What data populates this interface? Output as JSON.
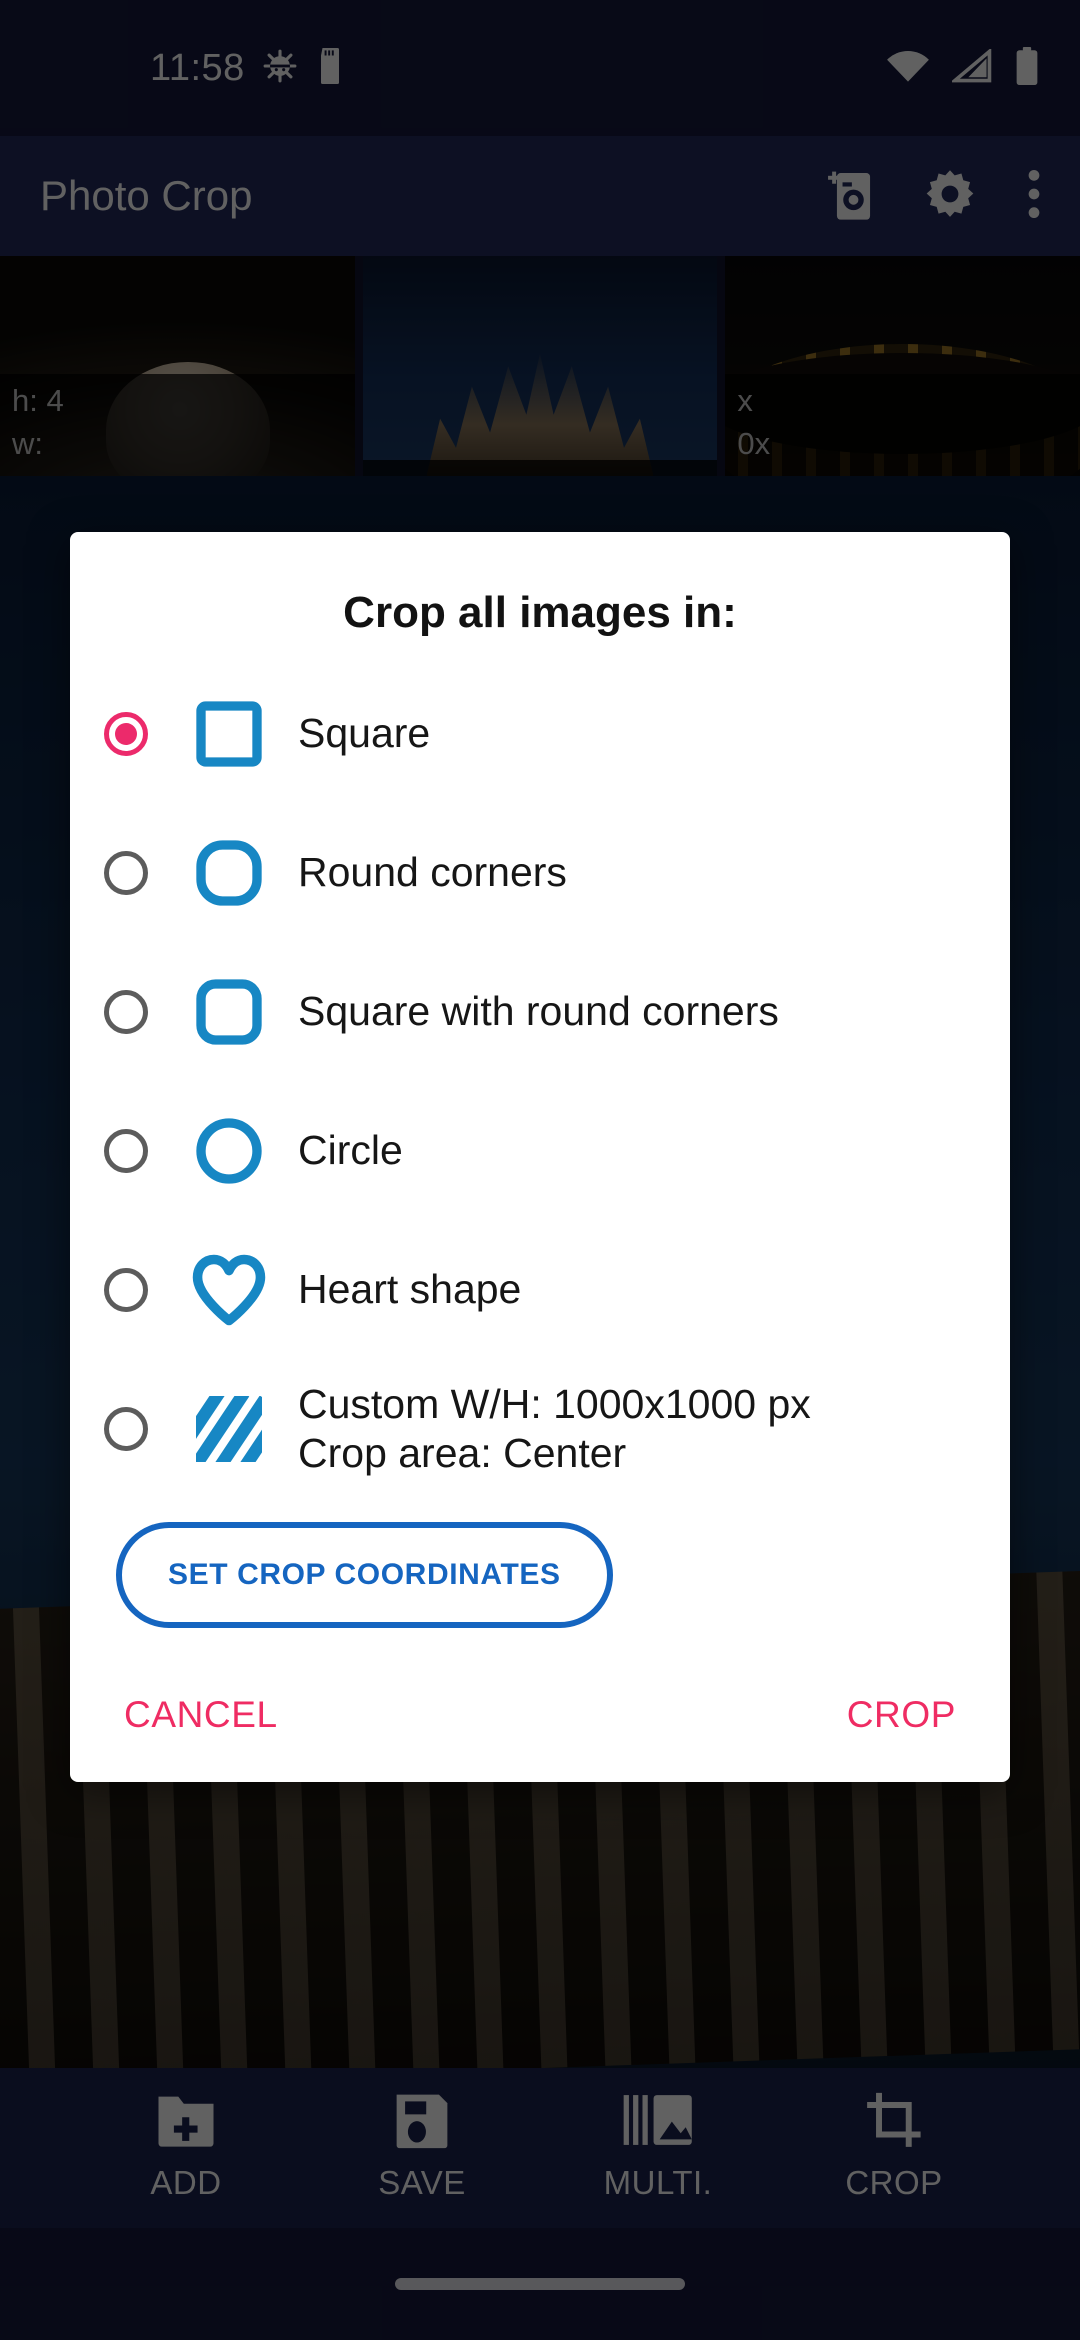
{
  "status_bar": {
    "time": "11:58",
    "icons": [
      "bug-icon",
      "sd-card-icon",
      "wifi-icon",
      "cellular-signal-icon",
      "battery-icon"
    ]
  },
  "app_bar": {
    "title": "Photo Crop",
    "actions": [
      "add-photo-icon",
      "settings-gear-icon",
      "overflow-menu-icon"
    ]
  },
  "thumbnails": [
    {
      "height_label": "h: 4",
      "width_label": "w:"
    },
    {
      "height_label": "",
      "width_label": ""
    },
    {
      "height_label": "x",
      "width_label": "0x"
    }
  ],
  "dialog": {
    "title": "Crop all images in:",
    "options": [
      {
        "label": "Square",
        "sub": "",
        "icon": "square-icon",
        "selected": true
      },
      {
        "label": "Round corners",
        "sub": "",
        "icon": "round-corners-icon",
        "selected": false
      },
      {
        "label": "Square with round corners",
        "sub": "",
        "icon": "square-round-icon",
        "selected": false
      },
      {
        "label": "Circle",
        "sub": "",
        "icon": "circle-icon",
        "selected": false
      },
      {
        "label": "Heart shape",
        "sub": "",
        "icon": "heart-icon",
        "selected": false
      },
      {
        "label": "Custom W/H: 1000x1000 px",
        "sub": "Crop area: Center",
        "icon": "diagonal-stripes-icon",
        "selected": false
      }
    ],
    "set_coords_label": "SET CROP COORDINATES",
    "cancel_label": "CANCEL",
    "confirm_label": "CROP"
  },
  "bottom_nav": [
    {
      "label": "ADD",
      "icon": "folder-add-icon"
    },
    {
      "label": "SAVE",
      "icon": "save-disk-icon"
    },
    {
      "label": "MULTI.",
      "icon": "multi-image-icon"
    },
    {
      "label": "CROP",
      "icon": "crop-tool-icon"
    }
  ],
  "colors": {
    "accent_pink": "#ec2a6b",
    "shape_blue": "#1787c4",
    "button_blue": "#1565c0",
    "app_bar": "#222a5c",
    "status_bar": "#151a3d"
  }
}
